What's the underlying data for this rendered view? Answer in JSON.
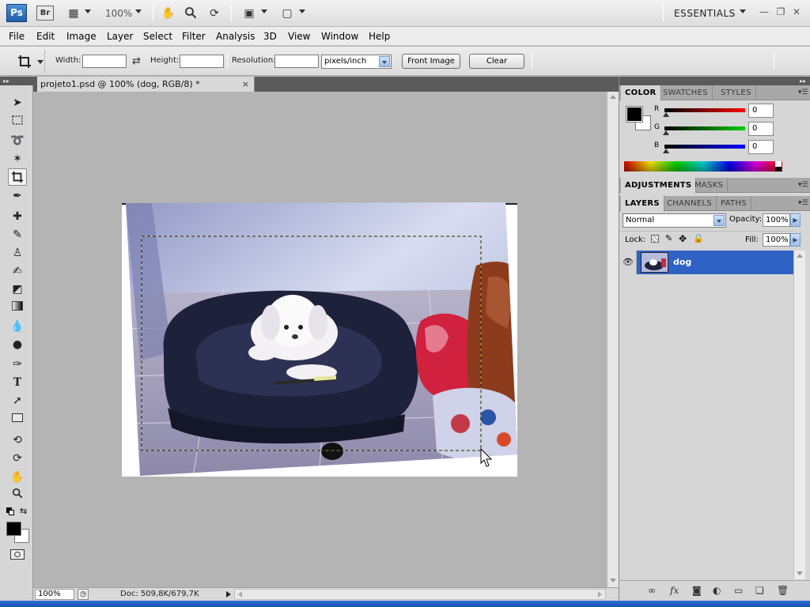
{
  "app": {
    "logo": "Ps",
    "bridge_logo": "Br",
    "zoom": "100%",
    "workspace": "ESSENTIALS"
  },
  "menu": [
    "File",
    "Edit",
    "Image",
    "Layer",
    "Select",
    "Filter",
    "Analysis",
    "3D",
    "View",
    "Window",
    "Help"
  ],
  "options": {
    "width_label": "Width:",
    "width_value": "",
    "height_label": "Height:",
    "height_value": "",
    "resolution_label": "Resolution:",
    "resolution_value": "",
    "units": "pixels/inch",
    "front_image": "Front Image",
    "clear": "Clear"
  },
  "document": {
    "tab_title": "projeto1.psd @ 100% (dog, RGB/8) *",
    "close": "×"
  },
  "status": {
    "zoom": "100%",
    "doc": "Doc: 509,8K/679,7K"
  },
  "color_panel": {
    "tabs": [
      "COLOR",
      "SWATCHES",
      "STYLES"
    ],
    "r_label": "R",
    "g_label": "G",
    "b_label": "B",
    "r": "0",
    "g": "0",
    "b": "0"
  },
  "adjust_panel": {
    "tabs": [
      "ADJUSTMENTS",
      "MASKS"
    ]
  },
  "layers_panel": {
    "tabs": [
      "LAYERS",
      "CHANNELS",
      "PATHS"
    ],
    "blend_mode": "Normal",
    "opacity_label": "Opacity:",
    "opacity": "100%",
    "lock_label": "Lock:",
    "fill_label": "Fill:",
    "fill": "100%",
    "layer_name": "dog"
  },
  "colors": {
    "accent": "#2f62c4",
    "foreground": "#000000",
    "background": "#ffffff"
  }
}
